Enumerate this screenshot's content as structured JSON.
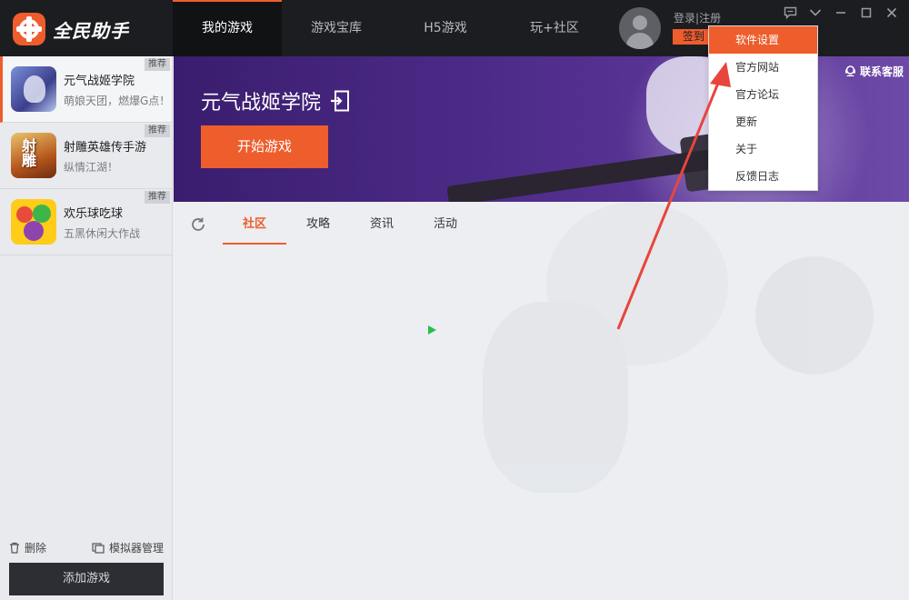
{
  "app": {
    "brand": "全民助手"
  },
  "nav": {
    "tabs": [
      {
        "label": "我的游戏",
        "active": true
      },
      {
        "label": "游戏宝库",
        "active": false
      },
      {
        "label": "H5游戏",
        "active": false
      },
      {
        "label": "玩+社区",
        "active": false
      }
    ]
  },
  "account": {
    "login": "登录",
    "separator": "|",
    "register": "注册",
    "checkin": "签到"
  },
  "window_controls": [
    "feedback-icon",
    "chevron-down-icon",
    "minimize-icon",
    "maximize-icon",
    "close-icon"
  ],
  "sidebar": {
    "games": [
      {
        "name": "元气战姬学院",
        "desc": "萌娘天团，燃爆G点！",
        "badge": "推荐",
        "active": true
      },
      {
        "name": "射雕英雄传手游",
        "desc": "纵情江湖！",
        "badge": "推荐",
        "active": false
      },
      {
        "name": "欢乐球吃球",
        "desc": "五黑休闲大作战",
        "badge": "推荐",
        "active": false
      }
    ],
    "delete_label": "删除",
    "emulator_label": "模拟器管理",
    "add_game_label": "添加游戏"
  },
  "banner": {
    "game_title": "元气战姬学院",
    "start_label": "开始游戏",
    "support_label": "联系客服"
  },
  "subtabs": [
    {
      "label": "社区",
      "active": true
    },
    {
      "label": "攻略",
      "active": false
    },
    {
      "label": "资讯",
      "active": false
    },
    {
      "label": "活动",
      "active": false
    }
  ],
  "menu": {
    "items": [
      {
        "label": "软件设置",
        "active": true
      },
      {
        "label": "官方网站",
        "active": false
      },
      {
        "label": "官方论坛",
        "active": false
      },
      {
        "label": "更新",
        "active": false
      },
      {
        "label": "关于",
        "active": false
      },
      {
        "label": "反馈日志",
        "active": false
      }
    ]
  },
  "colors": {
    "accent": "#ee5d2c",
    "topbar": "#1c1d21",
    "banner": "#4b2a86",
    "arrow": "#e8453c"
  }
}
